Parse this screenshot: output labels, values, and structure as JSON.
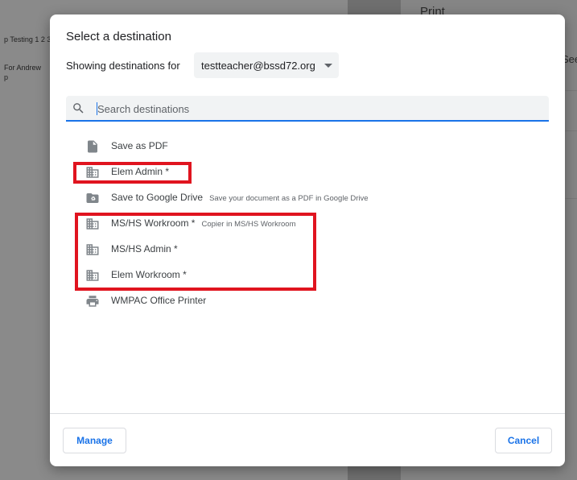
{
  "background": {
    "preview_text_line1": "p Testing 1 2 3",
    "preview_text_line2": "For Andrew",
    "preview_text_line3": "p",
    "panel_title": "Print",
    "panel_partial": "See"
  },
  "dialog": {
    "title": "Select a destination",
    "showing_label": "Showing destinations for",
    "account": "testteacher@bssd72.org",
    "search_placeholder": "Search destinations",
    "destinations": [
      {
        "label": "Save as PDF",
        "sub": "",
        "icon": "document-icon"
      },
      {
        "label": "Elem Admin *",
        "sub": "",
        "icon": "building-icon"
      },
      {
        "label": "Save to Google Drive",
        "sub": "Save your document as a PDF in Google Drive",
        "icon": "drive-folder-icon"
      },
      {
        "label": "MS/HS Workroom *",
        "sub": "Copier in MS/HS Workroom",
        "icon": "building-icon"
      },
      {
        "label": "MS/HS Admin *",
        "sub": "",
        "icon": "building-icon"
      },
      {
        "label": "Elem Workroom *",
        "sub": "",
        "icon": "building-icon"
      },
      {
        "label": "WMPAC Office Printer",
        "sub": "",
        "icon": "printer-icon"
      }
    ],
    "manage_label": "Manage",
    "cancel_label": "Cancel"
  },
  "colors": {
    "accent": "#1a73e8",
    "highlight": "#e0141f",
    "icon": "#80868b"
  }
}
